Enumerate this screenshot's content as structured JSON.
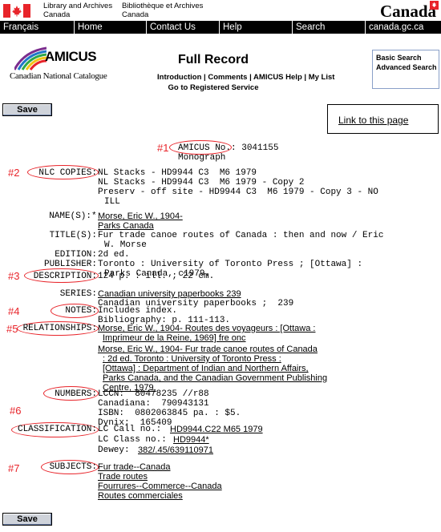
{
  "header": {
    "lac_en_1": "Library and Archives",
    "lac_en_2": "Canada",
    "lac_fr_1": "Bibliothèque et Archives",
    "lac_fr_2": "Canada",
    "wordmark": "Canada"
  },
  "nav": [
    "Français",
    "Home",
    "Contact Us",
    "Help",
    "Search",
    "canada.gc.ca"
  ],
  "amicus": {
    "logo_text": "AMICUS",
    "catalogue": "Canadian National Catalogue",
    "title": "Full Record",
    "links": [
      "Introduction",
      "Comments",
      "AMICUS Help",
      "My List"
    ],
    "registered": "Go to Registered Service",
    "search_links": [
      "Basic Search",
      "Advanced Search"
    ]
  },
  "save_label": "Save",
  "link_to_page": "Link to this page",
  "annotations": [
    "#1",
    "#2",
    "#3",
    "#4",
    "#5",
    "#6",
    "#7"
  ],
  "record": {
    "amicus_no_label": "AMICUS No.",
    "amicus_no": "3041155",
    "type": "Monograph",
    "nlc_label": "NLC COPIES:",
    "nlc": [
      "NL Stacks - HD9944 C3  M6 1979",
      "NL Stacks - HD9944 C3  M6 1979 - Copy 2",
      "Preserv - off site - HD9944 C3  M6 1979 - Copy 3 - NO",
      "ILL"
    ],
    "names_label": "NAME(S):",
    "names_prefix": "*",
    "names": [
      "Morse, Eric W., 1904-",
      "Parks Canada"
    ],
    "title_label": "TITLE(S):",
    "title": [
      "Fur trade canoe routes of Canada : then and now / Eric",
      "W. Morse"
    ],
    "edition_label": "EDITION:",
    "edition": "2d ed.",
    "publisher_label": "PUBLISHER:",
    "publisher": [
      "Toronto : University of Toronto Press ; [Ottawa] :",
      "Parks Canada, c1979."
    ],
    "description_label": "DESCRIPTION:",
    "description": "124 p. : ill. ; 22 cm.",
    "series_label": "SERIES:",
    "series_link": "Canadian university paperbooks 239",
    "series_text": "Canadian university paperbooks ;  239",
    "notes_label": "NOTES:",
    "notes": [
      "Includes index.",
      "Bibliography: p. 111-113."
    ],
    "relationships_label": "RELATIONSHIPS:",
    "relationships": [
      "Morse, Eric W., 1904- Routes des voyageurs : [Ottawa :",
      "Imprimeur de la Reine, 1969] fre onc",
      "Morse, Eric W., 1904- Fur trade canoe routes of Canada",
      ": 2d ed. Toronto : University of Toronto Press :",
      "[Ottawa] : Department of Indian and Northern Affairs,",
      "Parks Canada, and the Canadian Government Publishing",
      "Centre, 1979."
    ],
    "numbers_label": "NUMBERS:",
    "numbers": [
      "LCCN:  80478235 //r88",
      "Canadiana:  790943131",
      "ISBN:  0802063845 pa. : $5.",
      "Dynix:  165409"
    ],
    "classification_label": "CLASSIFICATION:",
    "lc_call_label": "LC Call no.:",
    "lc_call": "HD9944.C22 M65 1979",
    "lc_class_label": "LC Class no.:",
    "lc_class": "HD9944*",
    "dewey_label": "Dewey:",
    "dewey": "382/.45/639110971",
    "subjects_label": "SUBJECTS:",
    "subjects": [
      "Fur trade--Canada",
      "Trade routes",
      "Fourrures--Commerce--Canada",
      "Routes commerciales"
    ]
  }
}
